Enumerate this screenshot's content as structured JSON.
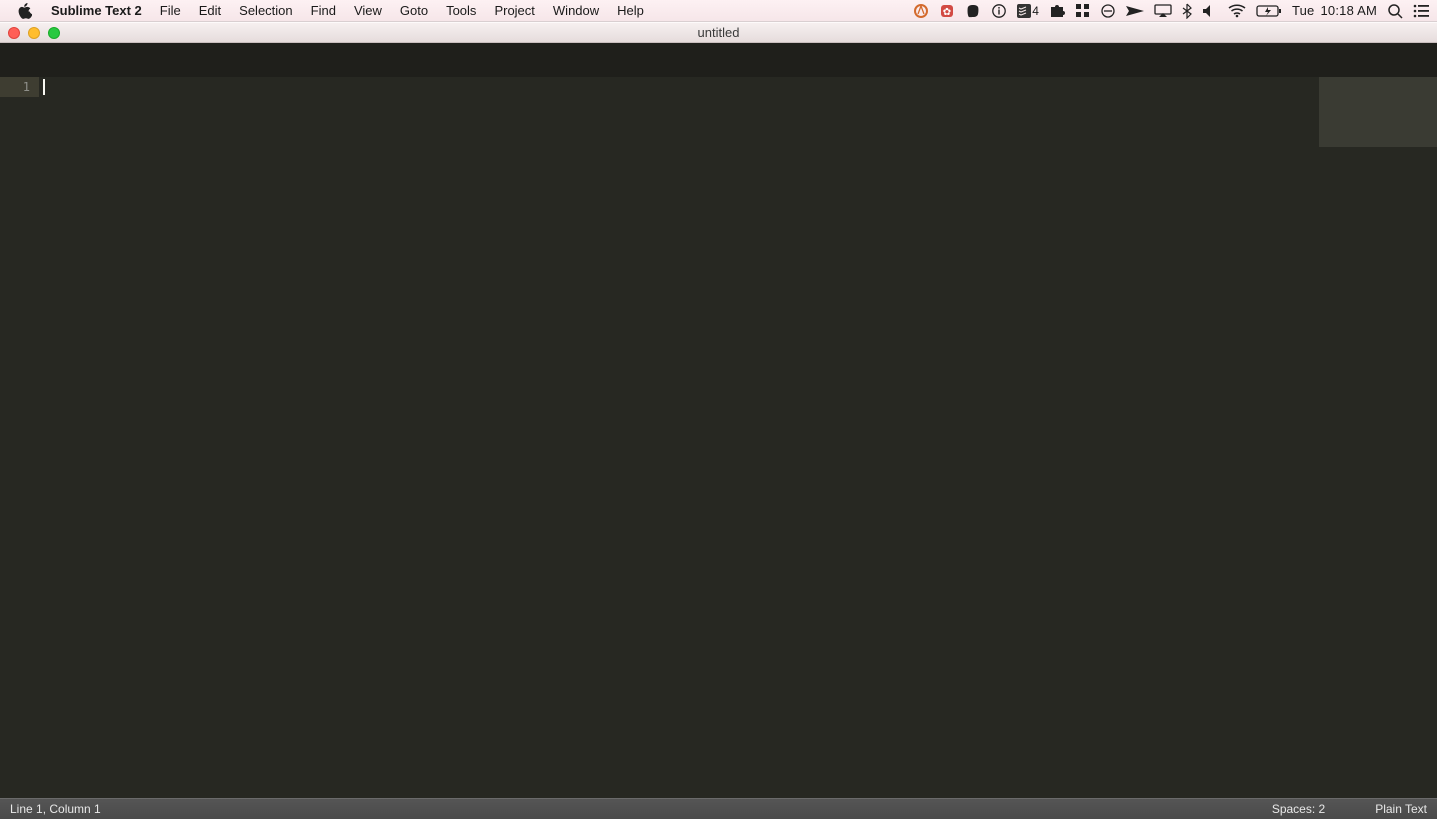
{
  "menubar": {
    "app_name": "Sublime Text 2",
    "items": [
      "File",
      "Edit",
      "Selection",
      "Find",
      "View",
      "Goto",
      "Tools",
      "Project",
      "Window",
      "Help"
    ],
    "tray_badge": "4",
    "clock_day": "Tue",
    "clock_time": "10:18 AM"
  },
  "window": {
    "title": "untitled"
  },
  "editor": {
    "line_number": "1"
  },
  "statusbar": {
    "position": "Line 1, Column 1",
    "indent": "Spaces: 2",
    "syntax": "Plain Text"
  }
}
